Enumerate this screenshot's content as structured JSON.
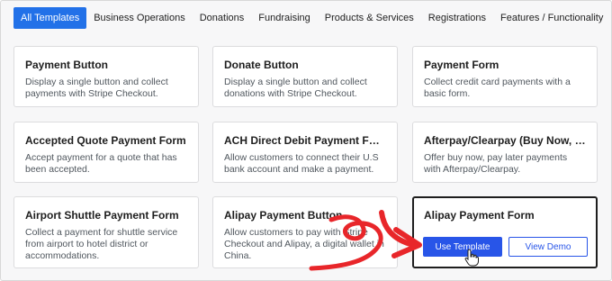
{
  "tabs": [
    {
      "label": "All Templates"
    },
    {
      "label": "Business Operations"
    },
    {
      "label": "Donations"
    },
    {
      "label": "Fundraising"
    },
    {
      "label": "Products & Services"
    },
    {
      "label": "Registrations"
    },
    {
      "label": "Features / Functionality"
    }
  ],
  "cards": [
    {
      "title": "Payment Button",
      "desc": "Display a single button and collect payments with Stripe Checkout."
    },
    {
      "title": "Donate Button",
      "desc": "Display a single button and collect donations with Stripe Checkout."
    },
    {
      "title": "Payment Form",
      "desc": "Collect credit card payments with a basic form."
    },
    {
      "title": "Accepted Quote Payment Form",
      "desc": "Accept payment for a quote that has been accepted."
    },
    {
      "title": "ACH Direct Debit Payment Form",
      "desc": "Allow customers to connect their U.S bank account and make a payment."
    },
    {
      "title": "Afterpay/Clearpay (Buy Now, Pay L...",
      "desc": "Offer buy now, pay later payments with Afterpay/Clearpay."
    },
    {
      "title": "Airport Shuttle Payment Form",
      "desc": "Collect a payment for shuttle service from airport to hotel district or accommodations."
    },
    {
      "title": "Alipay Payment Button",
      "desc": "Allow customers to pay with Stripe Checkout and Alipay, a digital wallet in China."
    },
    {
      "title": "Alipay Payment Form",
      "use_label": "Use Template",
      "demo_label": "View Demo"
    }
  ],
  "colors": {
    "accent": "#2271e8",
    "button": "#2855e8",
    "arrow": "#e8262a"
  }
}
